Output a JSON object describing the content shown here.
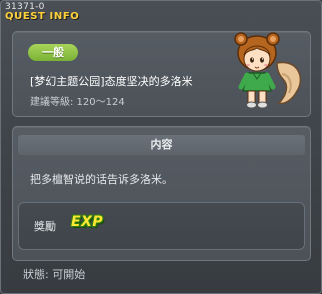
{
  "window": {
    "quest_id": "31371-0",
    "title": "QUEST INFO"
  },
  "quest": {
    "category": "一般",
    "name": "[梦幻主题公园]态度坚决的多洛米",
    "level_range": "建議等級: 120～124",
    "character_icon": "squirrel-girl-npc"
  },
  "content": {
    "header": "内容",
    "description": "把多檀智说的话告诉多洛米。"
  },
  "reward": {
    "label": "獎勵",
    "exp_label": "EXP"
  },
  "status": {
    "text": "狀態:  可開始"
  },
  "colors": {
    "title_yellow": "#ffd23a",
    "badge_green": "#8cc13f",
    "exp_yellow": "#ffe833"
  }
}
